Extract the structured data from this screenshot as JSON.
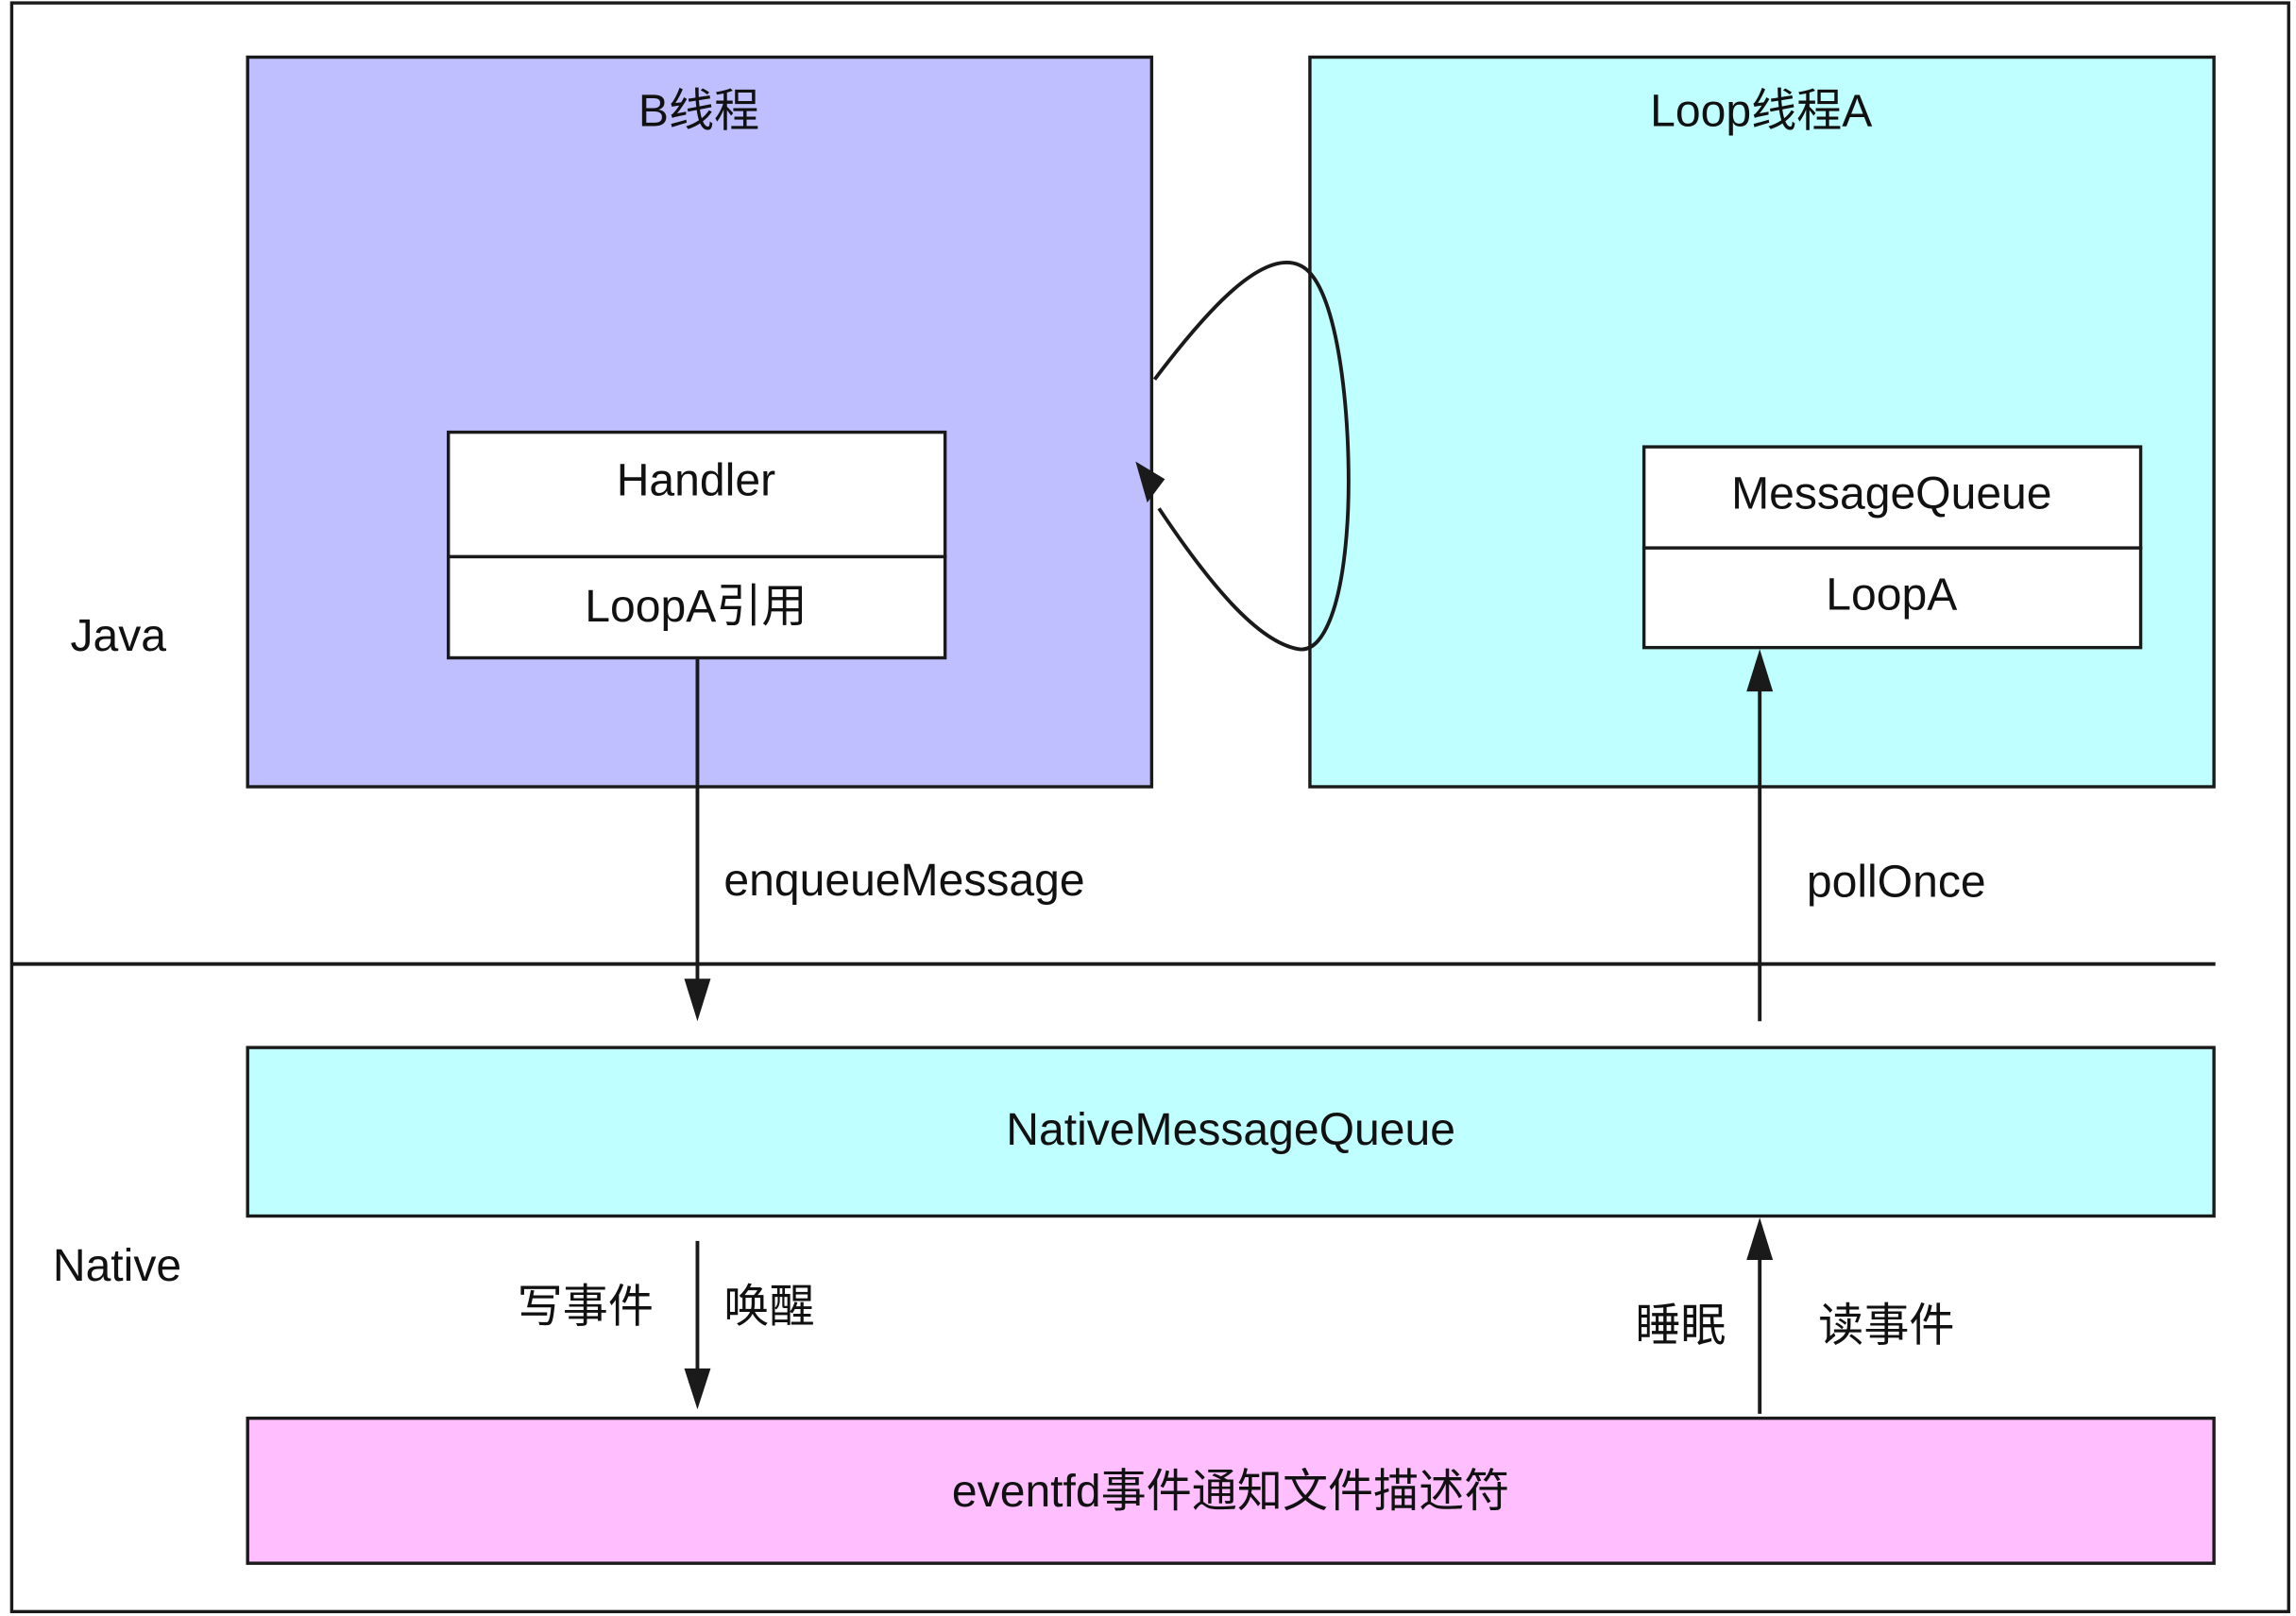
{
  "colors": {
    "thread_b": "#bfbfff",
    "loop_thread_a": "#bfffff",
    "native_message_queue": "#bfffff",
    "eventfd": "#ffbfff",
    "inner_box": "#ffffff",
    "stroke": "#1a1a1a"
  },
  "layers": {
    "java": "Java",
    "native": "Native"
  },
  "thread_b": {
    "title": "B线程",
    "handler": {
      "name": "Handler",
      "field": "LoopA引用"
    }
  },
  "loop_thread_a": {
    "title": "Loop线程A",
    "message_queue": {
      "name": "MessageQueue",
      "field": "LoopA"
    }
  },
  "native_message_queue": {
    "label": "NativeMessageQueue"
  },
  "eventfd": {
    "label": "eventfd事件通知文件描述符"
  },
  "edges": {
    "enqueue_message": "enqueueMessage",
    "poll_once": "pollOnce",
    "write_event": "写事件",
    "wake_up": "唤醒",
    "sleep": "睡眠",
    "read_event": "读事件"
  }
}
